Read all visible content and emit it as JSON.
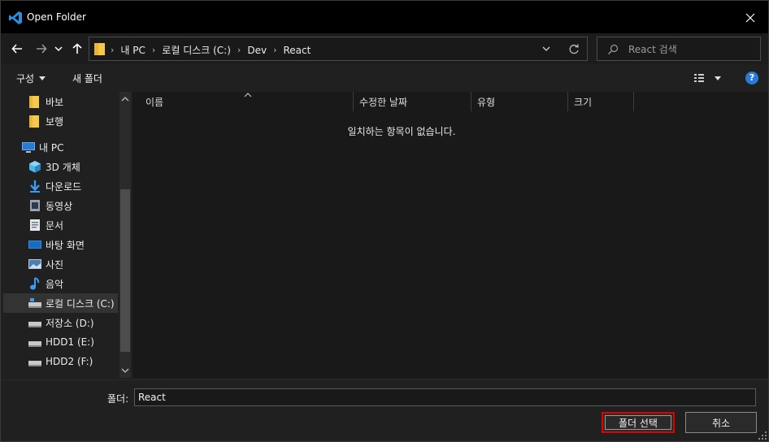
{
  "window": {
    "title": "Open Folder"
  },
  "address": {
    "crumbs": [
      "내 PC",
      "로컬 디스크 (C:)",
      "Dev",
      "React"
    ]
  },
  "search": {
    "placeholder": "React 검색"
  },
  "toolbar": {
    "organize_label": "구성",
    "new_folder_label": "새 폴더",
    "help_label": "?"
  },
  "nav": {
    "items": [
      {
        "label": "바보",
        "icon": "folder-icon"
      },
      {
        "label": "보행",
        "icon": "folder-icon"
      },
      {
        "label": "내 PC",
        "icon": "computer-icon"
      },
      {
        "label": "3D 개체",
        "icon": "cube-icon"
      },
      {
        "label": "다운로드",
        "icon": "download-icon"
      },
      {
        "label": "동영상",
        "icon": "video-icon"
      },
      {
        "label": "문서",
        "icon": "document-icon"
      },
      {
        "label": "바탕 화면",
        "icon": "desktop-icon"
      },
      {
        "label": "사진",
        "icon": "picture-icon"
      },
      {
        "label": "음악",
        "icon": "music-icon"
      },
      {
        "label": "로컬 디스크 (C:)",
        "icon": "drive-icon",
        "selected": true
      },
      {
        "label": "저장소 (D:)",
        "icon": "drive-icon"
      },
      {
        "label": "HDD1 (E:)",
        "icon": "drive-icon"
      },
      {
        "label": "HDD2 (F:)",
        "icon": "drive-icon"
      }
    ]
  },
  "table": {
    "columns": [
      "이름",
      "수정한 날짜",
      "유형",
      "크기"
    ],
    "empty_message": "일치하는 항목이 없습니다."
  },
  "footer": {
    "folder_label": "폴더:",
    "folder_value": "React",
    "select_button": "폴더 선택",
    "cancel_button": "취소"
  },
  "colors": {
    "accent_blue": "#2b79d8",
    "highlight_red": "#e00000",
    "folder_yellow": "#f5c84c"
  }
}
